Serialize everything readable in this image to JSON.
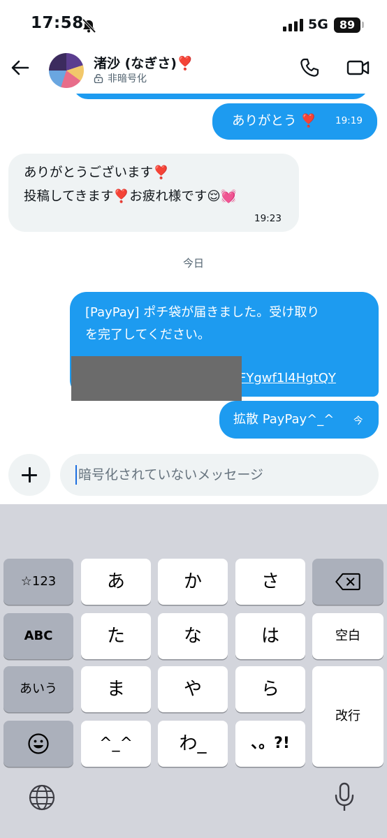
{
  "status_bar": {
    "time": "17:58",
    "network": "5G",
    "battery": "89",
    "icons": [
      "silent-bell-icon",
      "cellular-signal-icon"
    ]
  },
  "header": {
    "contact_name": "渚沙 (なぎさ)❣️",
    "encryption_status": "非暗号化",
    "icons": [
      "back-arrow-icon",
      "lock-open-icon",
      "phone-icon",
      "video-camera-icon"
    ]
  },
  "messages": [
    {
      "direction": "sent",
      "text": "ありがとう ❣️",
      "time": "19:19"
    },
    {
      "direction": "received",
      "lines": [
        "ありがとうございます❣️",
        "投稿してきます❣️お疲れ様です😌💓"
      ],
      "time": "19:23"
    },
    {
      "direction": "sent",
      "lines": [
        "[PayPay] ポチ袋が届きました。受け取り",
        "を完了してください。"
      ],
      "link_visible": "FYgwf1l4HgtQY"
    },
    {
      "direction": "sent",
      "text": "拡散 PayPay^_^",
      "time": "今"
    }
  ],
  "day_separator": "今日",
  "composer": {
    "placeholder": "暗号化されていないメッセージ"
  },
  "keyboard": {
    "row1": [
      "☆123",
      "あ",
      "か",
      "さ"
    ],
    "row2": [
      "ABC",
      "た",
      "な",
      "は",
      "空白"
    ],
    "row3": [
      "あいう",
      "ま",
      "や",
      "ら",
      "改行"
    ],
    "row4": [
      "^_^",
      "わ_",
      "、。?!"
    ],
    "icons": [
      "delete-key-icon",
      "emoji-icon",
      "globe-icon",
      "microphone-icon"
    ]
  },
  "colors": {
    "accent": "#1d9bf0",
    "received_bubble": "#eff3f4",
    "keyboard_bg": "#d3d5dc"
  }
}
